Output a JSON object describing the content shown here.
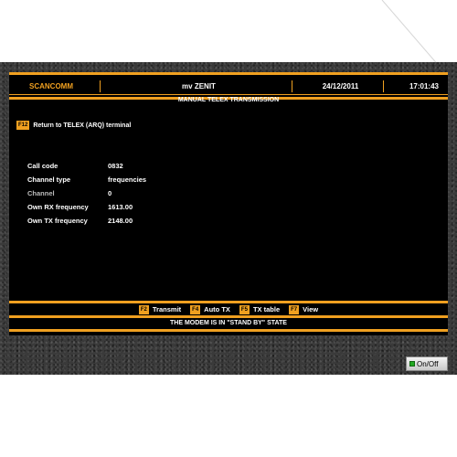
{
  "header": {
    "brand": "SCANCOMM",
    "vessel": "mv ZENIT",
    "date": "24/12/2011",
    "time": "17:01:43",
    "title": "MANUAL TELEX TRANSMISSION"
  },
  "return_action": {
    "key": "F12",
    "label": "Return to TELEX (ARQ) terminal"
  },
  "params": [
    {
      "label": "Call code",
      "value": "0832"
    },
    {
      "label": "Channel type",
      "value": "frequencies"
    },
    {
      "label": "Channel",
      "value": "0"
    },
    {
      "label": "Own RX frequency",
      "value": "1613.00"
    },
    {
      "label": "Own TX frequency",
      "value": "2148.00"
    }
  ],
  "function_keys": [
    {
      "key": "F2",
      "label": "Transmit"
    },
    {
      "key": "F4",
      "label": "Auto TX"
    },
    {
      "key": "F5",
      "label": "TX table"
    },
    {
      "key": "F7",
      "label": "View"
    }
  ],
  "status": "THE MODEM IS IN \"STAND BY\" STATE",
  "power_button": "On/Off",
  "colors": {
    "accent": "#f0a020",
    "screen": "#000000",
    "bezel": "#3a3a3a"
  }
}
